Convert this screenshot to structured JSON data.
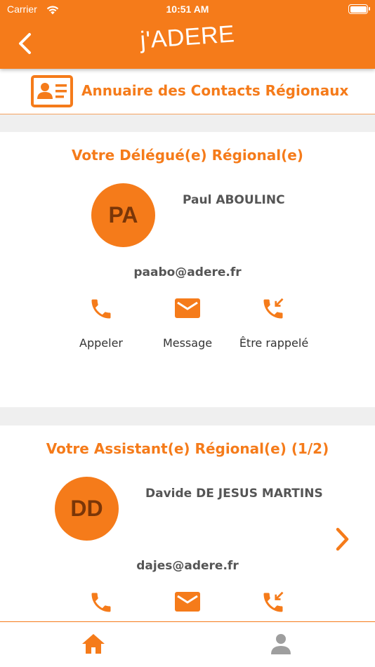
{
  "status_bar": {
    "carrier": "Carrier",
    "time": "10:51 AM"
  },
  "header": {
    "app_title": "j'ADERE",
    "back_icon": "chevron-left-icon"
  },
  "page": {
    "title": "Annuaire des Contacts Régionaux",
    "icon": "contact-card-icon"
  },
  "delegate": {
    "section_title": "Votre Délégué(e) Régional(e)",
    "initials": "PA",
    "name": "Paul ABOULINC",
    "email": "paabo@adere.fr",
    "actions": [
      {
        "label": "Appeler",
        "icon": "phone-icon"
      },
      {
        "label": "Message",
        "icon": "mail-icon"
      },
      {
        "label": "Être rappelé",
        "icon": "phone-callback-icon"
      }
    ]
  },
  "assistant": {
    "section_title": "Votre Assistant(e) Régional(e) (1/2)",
    "initials": "DD",
    "name": "Davide DE JESUS MARTINS",
    "email": "dajes@adere.fr",
    "next_icon": "chevron-right-icon"
  },
  "tabbar": {
    "items": [
      {
        "icon": "home-icon",
        "active": true
      },
      {
        "icon": "user-icon",
        "active": false
      }
    ]
  },
  "colors": {
    "accent": "#F57B1A",
    "avatar_text": "#7A3608",
    "band": "#EFEFEF",
    "inactive_tab": "#9E9E9E"
  }
}
